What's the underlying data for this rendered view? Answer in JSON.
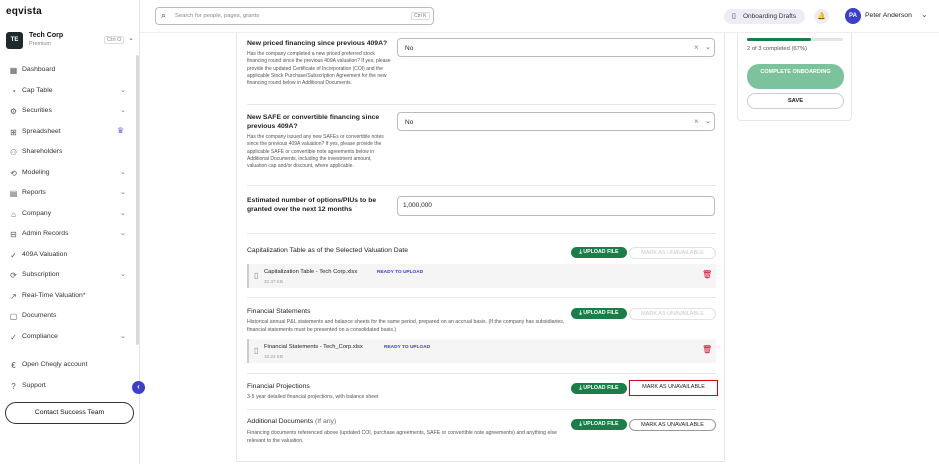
{
  "app": {
    "logo": "eqvista"
  },
  "org": {
    "initials": "TE",
    "name": "Tech Corp",
    "plan": "Premium",
    "shortcut": "Ctrl O"
  },
  "sidebar": {
    "items": [
      {
        "label": "Dashboard",
        "icon": "dashboard-icon",
        "glyph": "▦",
        "caret": false
      },
      {
        "label": "Cap Table",
        "icon": "cap-table-icon",
        "glyph": "◔",
        "caret": true
      },
      {
        "label": "Securities",
        "icon": "securities-icon",
        "glyph": "⚙",
        "caret": true
      },
      {
        "label": "Spreadsheet",
        "icon": "spreadsheet-icon",
        "glyph": "⊞",
        "caret": false,
        "crown": true
      },
      {
        "label": "Shareholders",
        "icon": "shareholders-icon",
        "glyph": "⚇",
        "caret": false
      },
      {
        "label": "Modeling",
        "icon": "modeling-icon",
        "glyph": "⟲",
        "caret": true
      },
      {
        "label": "Reports",
        "icon": "reports-icon",
        "glyph": "▤",
        "caret": true
      },
      {
        "label": "Company",
        "icon": "company-icon",
        "glyph": "⌂",
        "caret": true
      },
      {
        "label": "Admin Records",
        "icon": "admin-records-icon",
        "glyph": "⊟",
        "caret": true
      },
      {
        "label": "409A Valuation",
        "icon": "valuation-icon",
        "glyph": "✓",
        "caret": false
      },
      {
        "label": "Subscription",
        "icon": "subscription-icon",
        "glyph": "⟳",
        "caret": true
      },
      {
        "label": "Real-Time Valuation*",
        "icon": "realtime-valuation-icon",
        "glyph": "↗",
        "caret": false
      },
      {
        "label": "Documents",
        "icon": "documents-icon",
        "glyph": "▢",
        "caret": false
      },
      {
        "label": "Compliance",
        "icon": "compliance-icon",
        "glyph": "✓",
        "caret": true
      }
    ],
    "bottom": [
      {
        "label": "Open Cheqly account",
        "icon": "cheqly-icon",
        "glyph": "€"
      },
      {
        "label": "Support",
        "icon": "support-icon",
        "glyph": "?"
      }
    ],
    "contact_label": "Contact Success Team"
  },
  "topbar": {
    "search_placeholder": "Search for people, pages, grants",
    "search_shortcut": "Ctrl K",
    "drafts_label": "Onboarding Drafts",
    "user_initials": "PA",
    "user_name": "Peter Anderson"
  },
  "form": {
    "q1": {
      "title": "New priced financing since previous 409A?",
      "desc": "Has the company completed a new priced preferred stock financing round since the previous 409A valuation? If yes, please provide the updated Certificate of Incorporation (COI) and the applicable Stock Purchase/Subscription Agreement for the new financing round below in Additional Documents.",
      "value": "No"
    },
    "q2": {
      "title": "New SAFE or convertible financing since previous 409A?",
      "desc": "Has the company issued any new SAFEs or convertible notes since the previous 409A valuation? If yes, please provide the applicable SAFE or convertible note agreements below in Additional Documents, including the investment amount, valuation cap and/or discount, where applicable.",
      "value": "No"
    },
    "q3": {
      "title": "Estimated number of options/PIUs to be granted over the next 12 months",
      "value": "1,000,000"
    }
  },
  "documents": {
    "upload_label": "UPLOAD FILE",
    "mark_label": "MARK AS UNAVAILABLE",
    "cap_table": {
      "title": "Capitalization Table as of the Selected Valuation Date",
      "file_name": "Capitalization Table - Tech Corp.xlsx",
      "file_status": "READY TO UPLOAD",
      "file_size": "32.37 KB"
    },
    "financial_statements": {
      "title": "Financial Statements",
      "desc": "Historical annual P&L statements and balance sheets for the same period, prepared on an accrual basis. (If the company has subsidiaries, financial statements must be presented on a consolidated basis.)",
      "file_name": "Financial Statements - Tech_Corp.xlsx",
      "file_status": "READY TO UPLOAD",
      "file_size": "10.22 KB"
    },
    "financial_projections": {
      "title": "Financial Projections",
      "desc": "3-5 year detailed financial projections, with balance sheet"
    },
    "additional": {
      "title": "Additional Documents",
      "optional": "(If any)",
      "desc": "Financing documents referenced above (updated COI, purchase agreements, SAFE or convertible note agreements) and anything else relevant to the valuation."
    }
  },
  "progress": {
    "fraction": 0.67,
    "text": "2 of 3 completed (67%)",
    "complete_label": "COMPLETE ONBOARDING",
    "save_label": "SAVE"
  },
  "colors": {
    "accent": "#3b3fc9",
    "upload": "#1a7e49",
    "highlight": "#d6001c"
  }
}
